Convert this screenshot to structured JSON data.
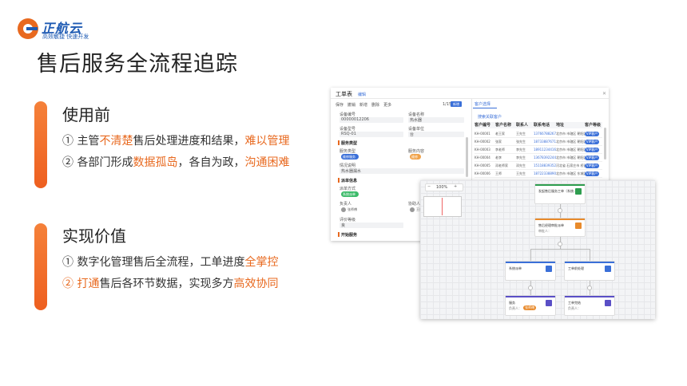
{
  "logo": {
    "name": "正航云",
    "slogan": "高效敏捷 快速开发"
  },
  "title": "售后服务全流程追踪",
  "before": {
    "heading": "使用前",
    "line1": {
      "a": "① 主管",
      "b": "不清楚",
      "c": "售后处理进度和结果，",
      "d": "难以管理"
    },
    "line2": {
      "a": "② 各部门形成",
      "b": "数据孤岛",
      "c": "，各自为政，",
      "d": "沟通困难"
    }
  },
  "value": {
    "heading": "实现价值",
    "line1": {
      "a": "① 数字化管理售后全流程，工单进度",
      "b": "全掌控"
    },
    "line2": {
      "a": "② 打通",
      "b": "售后各环节数据，实现多方",
      "c": "高效协同"
    }
  },
  "shot1": {
    "header": "工单表",
    "edit": "编辑",
    "toolbar": [
      "保存",
      "撤销",
      "新增",
      "删除",
      "更多"
    ],
    "pager": "1/15",
    "add_btn": "新增",
    "panel_tab": "客户选择",
    "panel_link": "搜索关联客户",
    "fields": [
      {
        "label": "设备编号",
        "value": "00000012206"
      },
      {
        "label": "设备名称",
        "value": "热水器"
      },
      {
        "label": "设备型号",
        "value": "RSQ-01"
      },
      {
        "label": "设备单位",
        "value": "台"
      }
    ],
    "sec_service": "服务类型",
    "service_label": "服务类型",
    "service_tag": "维修服务",
    "service_content_label": "服务内容",
    "service_content_tag": "维修",
    "problem_label": "情况说明",
    "problem_value": "热水器漏水",
    "sec_dispatch": "派单信息",
    "dispatch_label": "派单方式",
    "dispatch_tag": "系统派单",
    "person_label": "负责人",
    "person_name": "张师傅",
    "dept_label": "协助人",
    "dept_name": "王师傅",
    "evaluate_label": "评价等级",
    "evaluate_value": "良",
    "sec_start": "开始服务",
    "columns": [
      "客户编号",
      "客户名称",
      "联系人",
      "联系电话",
      "地址",
      "客户等级"
    ],
    "rows": [
      {
        "id": "KH-00001",
        "name": "老王家",
        "contact": "王先生",
        "phone": "13766788267",
        "addr": "北京市 市辖区 朝阳区",
        "level": "VIP客户"
      },
      {
        "id": "KH-00002",
        "name": "张家",
        "contact": "张先生",
        "phone": "18733887671",
        "addr": "北京市 市辖区 朝阳区",
        "level": "VIP客户"
      },
      {
        "id": "KH-00003",
        "name": "李老师",
        "contact": "李先生",
        "phone": "18911234416",
        "addr": "北京市 市辖区 朝阳区",
        "level": "VIP客户"
      },
      {
        "id": "KH-00004",
        "name": "老李",
        "contact": "李先生",
        "phone": "13678392244",
        "addr": "北京市 市辖区 朝阳区",
        "level": "VIP客户"
      },
      {
        "id": "KH-00005",
        "name": "邓老师家",
        "contact": "邓先生",
        "phone": "15118839352",
        "addr": "河北省 石家庄市 桥西区",
        "level": "VIP客户"
      },
      {
        "id": "KH-00006",
        "name": "王师",
        "contact": "王先生",
        "phone": "18722338890",
        "addr": "北京市 市辖区 东城区",
        "level": "VIP客户"
      }
    ]
  },
  "shot2": {
    "zoom": "100%",
    "nodes": [
      {
        "title": "发起售后服务工单（系统…）",
        "color": "#2e9d4f"
      },
      {
        "title": "售后经理审批派单",
        "sub": "审批人：",
        "color": "#e88a2b"
      },
      {
        "title": "系统派单",
        "color": "#3a6fd8"
      },
      {
        "title": "工单前处理",
        "color": "#3a6fd8"
      },
      {
        "title": "服务",
        "sub": "负责人：",
        "tag": "张师傅",
        "color": "#5a4fc6"
      },
      {
        "title": "工单完结",
        "sub": "负责人：",
        "color": "#5a4fc6"
      }
    ]
  },
  "colors": {
    "accent": "#e8691f",
    "brand": "#1f5bb3"
  }
}
